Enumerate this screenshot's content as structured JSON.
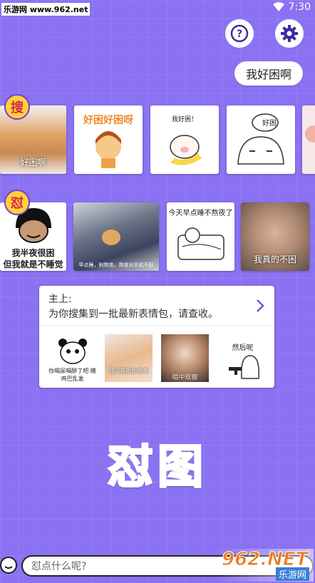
{
  "status": {
    "watermark": "乐游网 www.962.net",
    "time": "7:30"
  },
  "header": {
    "help_symbol": "?",
    "help_icon": "question-icon",
    "settings_icon": "gear-icon"
  },
  "bubble": {
    "text": "我好困啊"
  },
  "search_row": {
    "badge": "搜",
    "tiles": [
      {
        "caption": "好困啊"
      },
      {
        "caption": "好困好困呀"
      },
      {
        "caption": "我好困！"
      },
      {
        "caption": "好困"
      }
    ]
  },
  "retort_row": {
    "badge": "怼",
    "tiles": [
      {
        "caption_top": "我半夜很困",
        "caption_bottom": "但我就是不睡觉"
      },
      {
        "caption": "早点睡，别熬夜，熬夜对手机不好"
      },
      {
        "caption": "今天早点睡不熬夜了"
      },
      {
        "caption": "我真的不困"
      }
    ]
  },
  "card": {
    "title": "主上:",
    "subtitle": "为你搜集到一批最新表情包，请查收。",
    "thumbs": [
      {
        "caption": "你喝尿喝醉了吧 瞎鸡巴乱发"
      },
      {
        "caption": "我没有跟你商量"
      },
      {
        "caption": "暗中观察"
      },
      {
        "caption": "然后呢"
      }
    ]
  },
  "big_title": "怼图",
  "input": {
    "placeholder": "怼点什么呢?"
  },
  "logo": {
    "text": "962.NET",
    "sub": "乐游网"
  },
  "colors": {
    "background": "#8a72f2",
    "title": "#2fe0ea",
    "accent": "#6a57d8"
  }
}
